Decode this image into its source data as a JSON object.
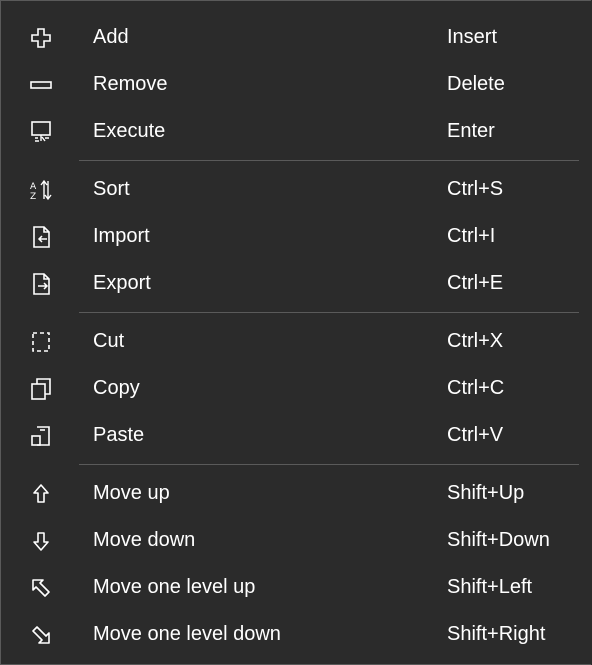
{
  "menu": {
    "groups": [
      {
        "items": [
          {
            "icon": "add-icon",
            "label": "Add",
            "shortcut": "Insert"
          },
          {
            "icon": "remove-icon",
            "label": "Remove",
            "shortcut": "Delete"
          },
          {
            "icon": "execute-icon",
            "label": "Execute",
            "shortcut": "Enter"
          }
        ]
      },
      {
        "items": [
          {
            "icon": "sort-icon",
            "label": "Sort",
            "shortcut": "Ctrl+S"
          },
          {
            "icon": "import-icon",
            "label": "Import",
            "shortcut": "Ctrl+I"
          },
          {
            "icon": "export-icon",
            "label": "Export",
            "shortcut": "Ctrl+E"
          }
        ]
      },
      {
        "items": [
          {
            "icon": "cut-icon",
            "label": "Cut",
            "shortcut": "Ctrl+X"
          },
          {
            "icon": "copy-icon",
            "label": "Copy",
            "shortcut": "Ctrl+C"
          },
          {
            "icon": "paste-icon",
            "label": "Paste",
            "shortcut": "Ctrl+V"
          }
        ]
      },
      {
        "items": [
          {
            "icon": "arrow-up-icon",
            "label": "Move up",
            "shortcut": "Shift+Up"
          },
          {
            "icon": "arrow-down-icon",
            "label": "Move down",
            "shortcut": "Shift+Down"
          },
          {
            "icon": "arrow-up-left-icon",
            "label": "Move one level up",
            "shortcut": "Shift+Left"
          },
          {
            "icon": "arrow-down-right-icon",
            "label": "Move one level down",
            "shortcut": "Shift+Right"
          }
        ]
      }
    ],
    "colors": {
      "background": "#2b2b2b",
      "text": "#ffffff",
      "separator": "#5a5a5a"
    }
  }
}
